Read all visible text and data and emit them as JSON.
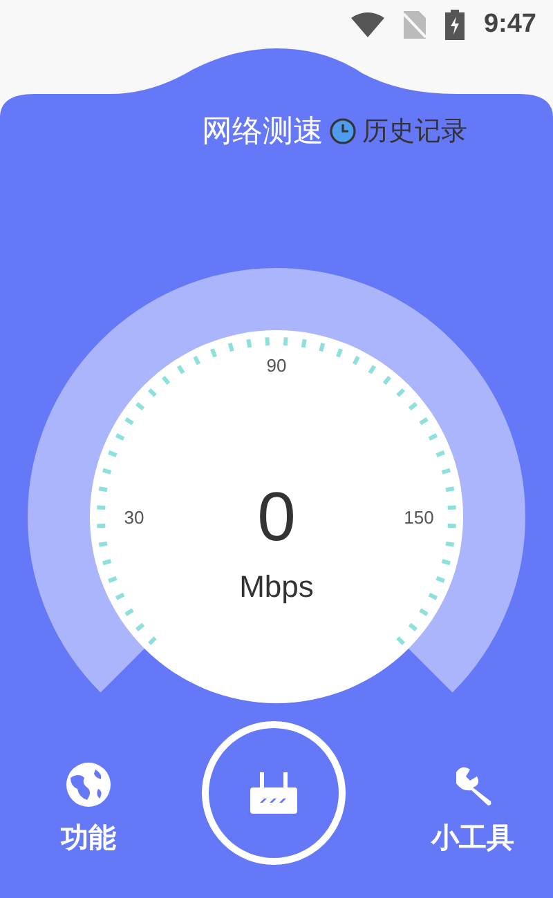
{
  "status_bar": {
    "time": "9:47"
  },
  "header": {
    "title": "网络测速",
    "history": "历史记录"
  },
  "gauge": {
    "scale": [
      "30",
      "90",
      "150"
    ],
    "value": "0",
    "unit": "Mbps"
  },
  "nav": {
    "left_label": "功能",
    "right_label": "小工具"
  }
}
